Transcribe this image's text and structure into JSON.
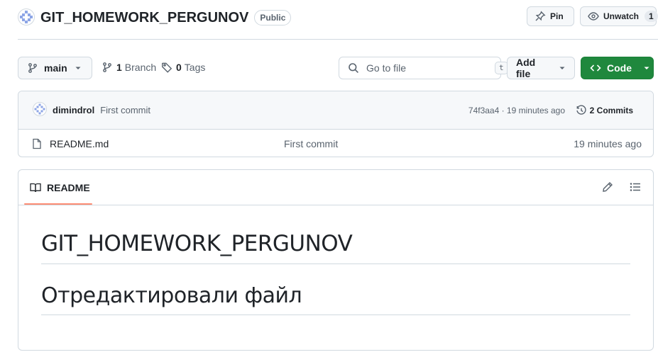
{
  "repo": {
    "name": "GIT_HOMEWORK_PERGUNOV",
    "visibility": "Public"
  },
  "header_actions": {
    "pin_label": "Pin",
    "watch_label": "Unwatch",
    "watch_count": "1"
  },
  "toolbar": {
    "branch_label": "main",
    "branches_count": "1",
    "branches_label": "Branch",
    "tags_count": "0",
    "tags_label": "Tags",
    "search_placeholder": "Go to file",
    "search_shortcut": "t",
    "add_file_label": "Add file",
    "code_label": "Code"
  },
  "latest_commit": {
    "author": "dimindrol",
    "message": "First commit",
    "hash_time": "74f3aa4 · 19 minutes ago",
    "commits_label": "2 Commits"
  },
  "files": [
    {
      "name": "README.md",
      "commit_message": "First commit",
      "age": "19 minutes ago"
    }
  ],
  "readme": {
    "tab_label": "README",
    "heading1": "GIT_HOMEWORK_PERGUNOV",
    "heading2": "Отредактировали файл"
  },
  "icons": {
    "avatar": "identicon-avatar",
    "pin": "pin-icon",
    "watch": "eye-icon",
    "branch": "git-branch-icon",
    "tag": "tag-icon",
    "search": "search-icon",
    "code": "code-icon",
    "history": "history-icon",
    "file": "file-icon",
    "book": "book-icon",
    "edit": "pencil-icon",
    "outline": "list-unordered-icon"
  },
  "colors": {
    "accent_green": "#1f883d",
    "tab_underline": "#fd8c73",
    "border": "#d1d9e0",
    "muted_text": "#59636e"
  }
}
